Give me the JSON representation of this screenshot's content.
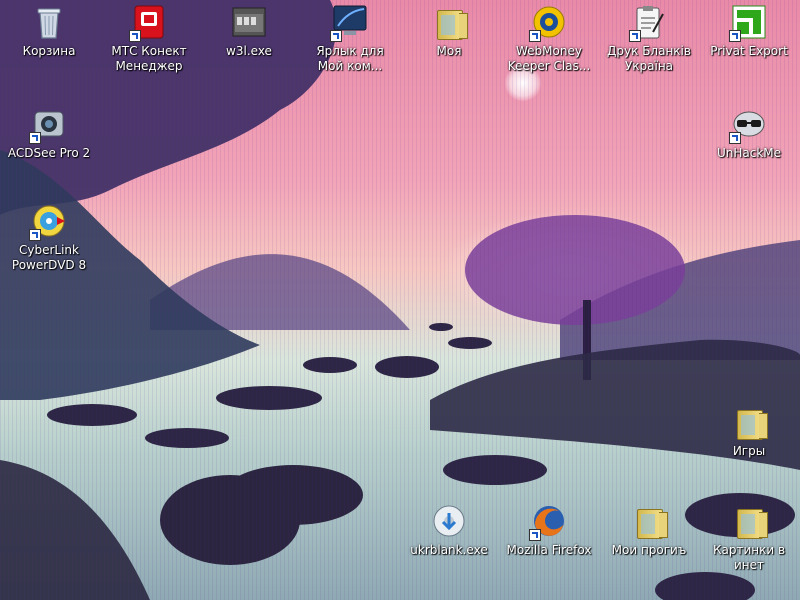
{
  "desktop": {
    "icons": [
      {
        "label": "Корзина"
      },
      {
        "label": "МТС Конект\nМенеджер"
      },
      {
        "label": "w3l.exe"
      },
      {
        "label": "Ярлык для\nМой ком..."
      },
      {
        "label": "Моя"
      },
      {
        "label": "WebMoney\nKeeper Clas..."
      },
      {
        "label": "Друк Бланків\nУкраїна"
      },
      {
        "label": "Privat Export"
      },
      {
        "label": "ACDSee Pro 2"
      },
      {
        "label": "UnHackMe"
      },
      {
        "label": "CyberLink\nPowerDVD 8"
      },
      {
        "label": "Игры"
      },
      {
        "label": "ukrblank.exe"
      },
      {
        "label": "Mozilla Firefox"
      },
      {
        "label": "Мои прогиъ"
      },
      {
        "label": "Картинки в\nинет"
      }
    ]
  }
}
